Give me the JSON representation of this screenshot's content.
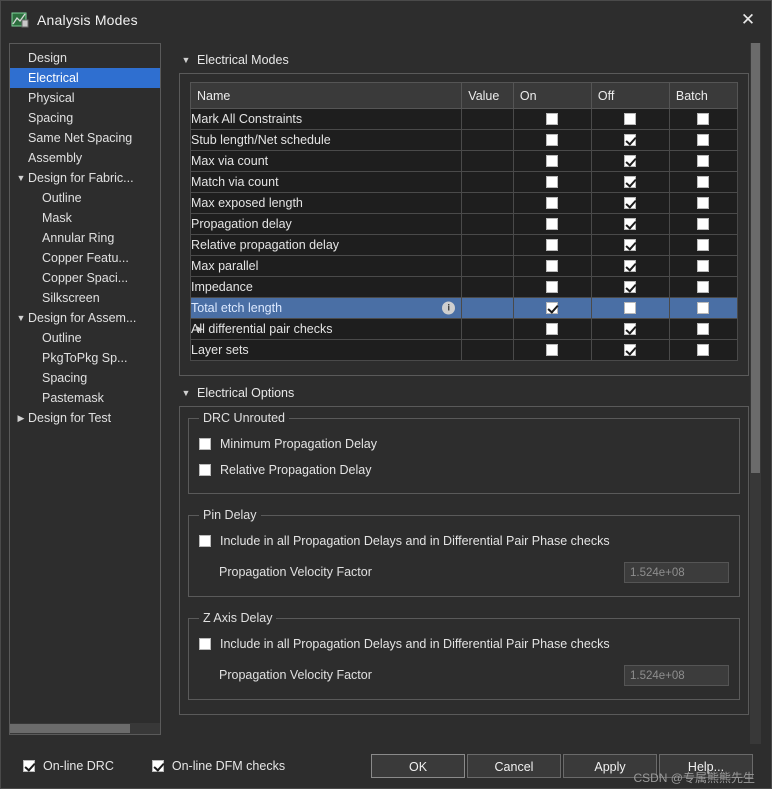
{
  "window": {
    "title": "Analysis Modes",
    "close_label": "✕"
  },
  "tree": {
    "items": [
      {
        "label": "Design",
        "indent": 1,
        "twisty": "",
        "selected": false
      },
      {
        "label": "Electrical",
        "indent": 1,
        "twisty": "",
        "selected": true
      },
      {
        "label": "Physical",
        "indent": 1,
        "twisty": "",
        "selected": false
      },
      {
        "label": "Spacing",
        "indent": 1,
        "twisty": "",
        "selected": false
      },
      {
        "label": "Same Net Spacing",
        "indent": 1,
        "twisty": "",
        "selected": false
      },
      {
        "label": "Assembly",
        "indent": 1,
        "twisty": "",
        "selected": false
      },
      {
        "label": "Design for Fabric...",
        "indent": 0,
        "twisty": "down",
        "selected": false
      },
      {
        "label": "Outline",
        "indent": 2,
        "twisty": "",
        "selected": false
      },
      {
        "label": "Mask",
        "indent": 2,
        "twisty": "",
        "selected": false
      },
      {
        "label": "Annular Ring",
        "indent": 2,
        "twisty": "",
        "selected": false
      },
      {
        "label": "Copper Featu...",
        "indent": 2,
        "twisty": "",
        "selected": false
      },
      {
        "label": "Copper Spaci...",
        "indent": 2,
        "twisty": "",
        "selected": false
      },
      {
        "label": "Silkscreen",
        "indent": 2,
        "twisty": "",
        "selected": false
      },
      {
        "label": "Design for Assem...",
        "indent": 0,
        "twisty": "down",
        "selected": false
      },
      {
        "label": "Outline",
        "indent": 2,
        "twisty": "",
        "selected": false
      },
      {
        "label": "PkgToPkg Sp...",
        "indent": 2,
        "twisty": "",
        "selected": false
      },
      {
        "label": "Spacing",
        "indent": 2,
        "twisty": "",
        "selected": false
      },
      {
        "label": "Pastemask",
        "indent": 2,
        "twisty": "",
        "selected": false
      },
      {
        "label": "Design for Test",
        "indent": 0,
        "twisty": "right",
        "selected": false
      }
    ]
  },
  "sections": {
    "electrical_modes": "Electrical Modes",
    "electrical_options": "Electrical Options"
  },
  "table": {
    "headers": [
      "Name",
      "Value",
      "On",
      "Off",
      "Batch"
    ],
    "rows": [
      {
        "name": "Mark All Constraints",
        "value": "",
        "on": false,
        "off": false,
        "batch": false,
        "expander": false,
        "info": false,
        "selected": false
      },
      {
        "name": "Stub length/Net schedule",
        "value": "",
        "on": false,
        "off": true,
        "batch": false,
        "expander": false,
        "info": false,
        "selected": false
      },
      {
        "name": "Max via count",
        "value": "",
        "on": false,
        "off": true,
        "batch": false,
        "expander": false,
        "info": false,
        "selected": false
      },
      {
        "name": "Match via count",
        "value": "",
        "on": false,
        "off": true,
        "batch": false,
        "expander": false,
        "info": false,
        "selected": false
      },
      {
        "name": "Max exposed length",
        "value": "",
        "on": false,
        "off": true,
        "batch": false,
        "expander": false,
        "info": false,
        "selected": false
      },
      {
        "name": "Propagation delay",
        "value": "",
        "on": false,
        "off": true,
        "batch": false,
        "expander": false,
        "info": false,
        "selected": false
      },
      {
        "name": "Relative propagation delay",
        "value": "",
        "on": false,
        "off": true,
        "batch": false,
        "expander": false,
        "info": false,
        "selected": false
      },
      {
        "name": "Max parallel",
        "value": "",
        "on": false,
        "off": true,
        "batch": false,
        "expander": false,
        "info": false,
        "selected": false
      },
      {
        "name": "Impedance",
        "value": "",
        "on": false,
        "off": true,
        "batch": false,
        "expander": false,
        "info": false,
        "selected": false
      },
      {
        "name": "Total etch length",
        "value": "",
        "on": true,
        "off": false,
        "batch": false,
        "expander": false,
        "info": true,
        "selected": true
      },
      {
        "name": "All differential pair checks",
        "value": "",
        "on": false,
        "off": true,
        "batch": false,
        "expander": true,
        "info": false,
        "selected": false
      },
      {
        "name": "Layer sets",
        "value": "",
        "on": false,
        "off": true,
        "batch": false,
        "expander": false,
        "info": false,
        "selected": false
      }
    ]
  },
  "options": {
    "drc_unrouted": {
      "legend": "DRC Unrouted",
      "items": [
        {
          "label": "Minimum Propagation Delay",
          "checked": false
        },
        {
          "label": "Relative Propagation Delay",
          "checked": false
        }
      ]
    },
    "pin_delay": {
      "legend": "Pin Delay",
      "checkbox_label": "Include in all Propagation Delays and in Differential Pair Phase checks",
      "checked": false,
      "field_label": "Propagation Velocity Factor",
      "field_value": "1.524e+08"
    },
    "z_axis_delay": {
      "legend": "Z Axis Delay",
      "checkbox_label": "Include in all Propagation Delays and in Differential Pair Phase checks",
      "checked": false,
      "field_label": "Propagation Velocity Factor",
      "field_value": "1.524e+08"
    }
  },
  "footer": {
    "online_drc": {
      "label": "On-line DRC",
      "checked": true
    },
    "online_dfm": {
      "label": "On-line DFM checks",
      "checked": true
    },
    "buttons": [
      {
        "label": "OK"
      },
      {
        "label": "Cancel"
      },
      {
        "label": "Apply"
      },
      {
        "label": "Help..."
      }
    ]
  },
  "watermark": "CSDN @专属熊熊先生"
}
